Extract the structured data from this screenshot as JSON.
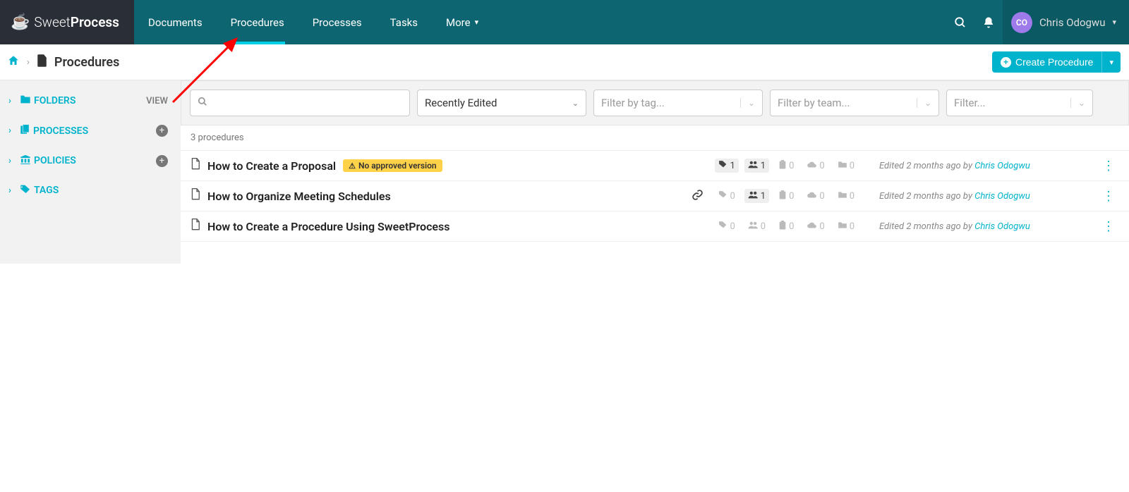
{
  "brand": {
    "name_a": "Sweet",
    "name_b": "Process"
  },
  "nav": {
    "items": [
      {
        "label": "Documents",
        "active": false
      },
      {
        "label": "Procedures",
        "active": true
      },
      {
        "label": "Processes",
        "active": false
      },
      {
        "label": "Tasks",
        "active": false
      },
      {
        "label": "More",
        "active": false,
        "caret": true
      }
    ]
  },
  "user": {
    "initials": "CO",
    "name": "Chris Odogwu"
  },
  "breadcrumb": {
    "title": "Procedures"
  },
  "create_button": {
    "label": "Create Procedure"
  },
  "sidebar": {
    "items": [
      {
        "label": "FOLDERS",
        "right_type": "text",
        "right_text": "VIEW"
      },
      {
        "label": "PROCESSES",
        "right_type": "plus"
      },
      {
        "label": "POLICIES",
        "right_type": "plus"
      },
      {
        "label": "TAGS",
        "right_type": "none"
      }
    ]
  },
  "filters": {
    "sort": "Recently Edited",
    "tag_placeholder": "Filter by tag...",
    "team_placeholder": "Filter by team...",
    "generic_placeholder": "Filter..."
  },
  "count_text": "3 procedures",
  "warn_label": "No approved version",
  "edited_prefix": "Edited 2 months ago by ",
  "rows": [
    {
      "title": "How to Create a Proposal",
      "warn": true,
      "link_icon": false,
      "metrics": {
        "tags": {
          "n": "1",
          "active": true
        },
        "people": {
          "n": "1",
          "active": true
        },
        "tasks": {
          "n": "0",
          "active": false
        },
        "cloud": {
          "n": "0",
          "active": false
        },
        "folder": {
          "n": "0",
          "active": false
        }
      },
      "author": "Chris Odogwu"
    },
    {
      "title": "How to Organize Meeting Schedules",
      "warn": false,
      "link_icon": true,
      "metrics": {
        "tags": {
          "n": "0",
          "active": false
        },
        "people": {
          "n": "1",
          "active": true
        },
        "tasks": {
          "n": "0",
          "active": false
        },
        "cloud": {
          "n": "0",
          "active": false
        },
        "folder": {
          "n": "0",
          "active": false
        }
      },
      "author": "Chris Odogwu"
    },
    {
      "title": "How to Create a Procedure Using SweetProcess",
      "warn": false,
      "link_icon": false,
      "metrics": {
        "tags": {
          "n": "0",
          "active": false
        },
        "people": {
          "n": "0",
          "active": false
        },
        "tasks": {
          "n": "0",
          "active": false
        },
        "cloud": {
          "n": "0",
          "active": false
        },
        "folder": {
          "n": "0",
          "active": false
        }
      },
      "author": "Chris Odogwu"
    }
  ]
}
